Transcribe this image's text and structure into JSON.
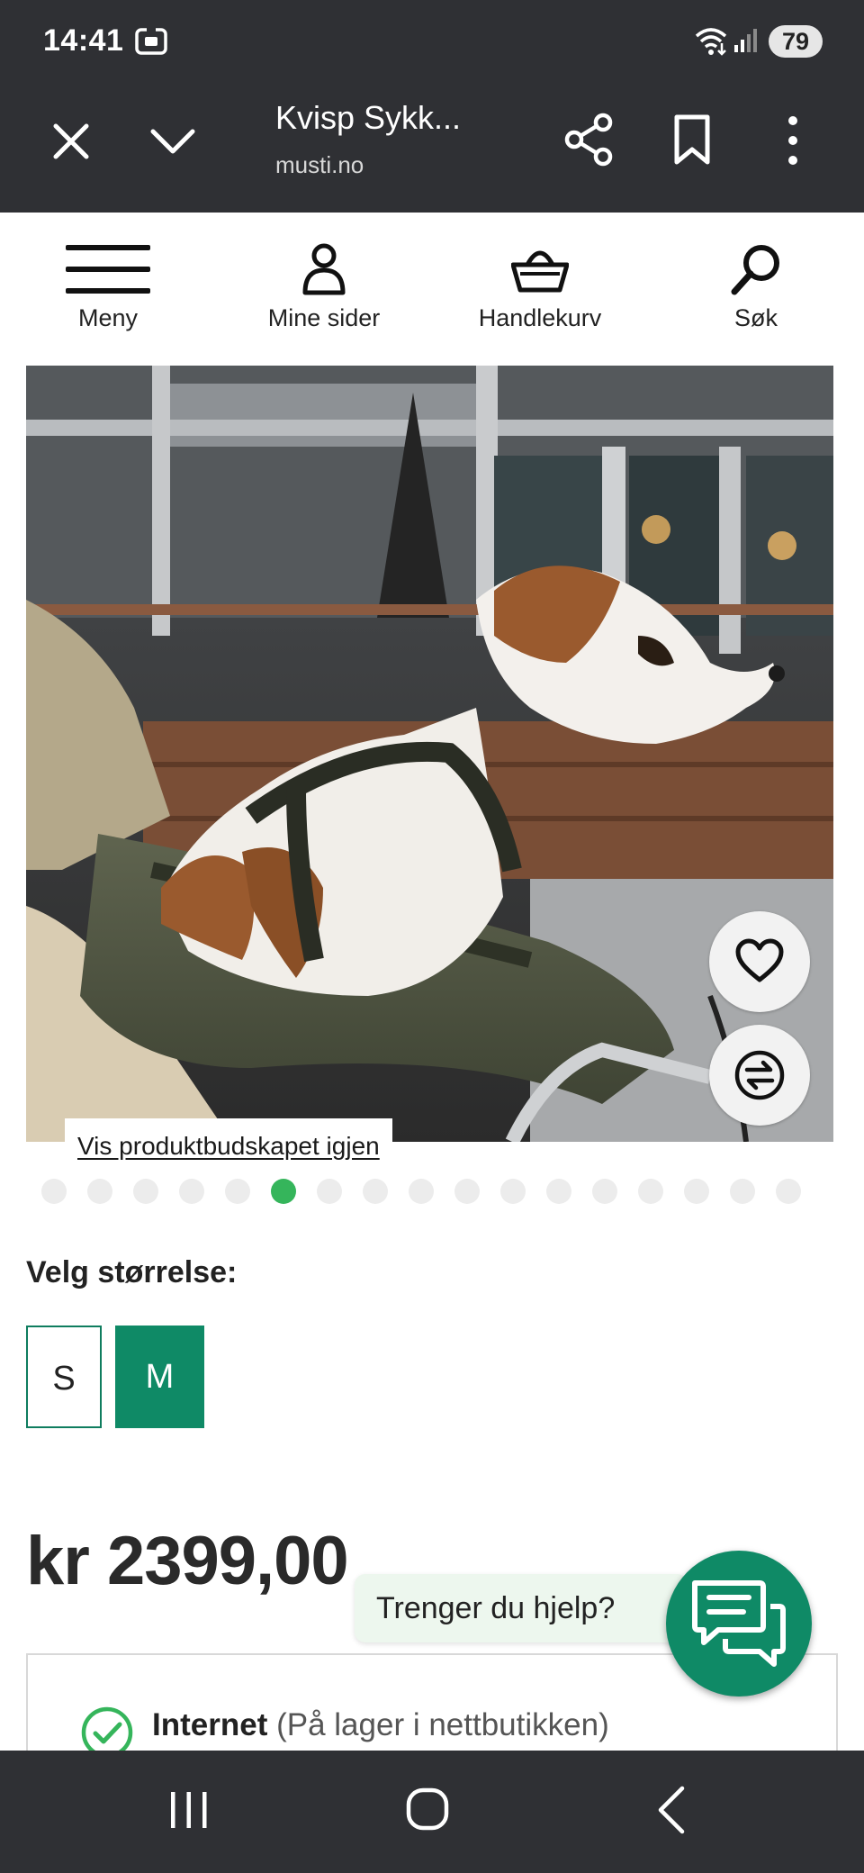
{
  "status_bar": {
    "time": "14:41",
    "battery": "79",
    "icons": [
      "screenshot-icon",
      "wifi-icon",
      "signal-icon"
    ]
  },
  "browser": {
    "tab_title": "Kvisp Sykk...",
    "url": "musti.no",
    "icons": [
      "close-icon",
      "chevron-down-icon",
      "share-icon",
      "bookmark-icon",
      "more-vert-icon"
    ]
  },
  "nav": {
    "menu": "Meny",
    "account": "Mine sider",
    "cart": "Handlekurv",
    "search": "Søk"
  },
  "product": {
    "show_message_link": "Vis produktbudskapet igjen",
    "image_count": 17,
    "active_image_index": 5,
    "size_heading": "Velg størrelse:",
    "sizes": [
      {
        "label": "S",
        "selected": false
      },
      {
        "label": "M",
        "selected": true
      }
    ],
    "price": "kr 2399,00"
  },
  "help": {
    "label": "Trenger du hjelp?"
  },
  "stock": {
    "channel": "Internet",
    "detail": "(På lager i nettbutikken)"
  },
  "colors": {
    "brand_green": "#0f8a66",
    "dot_active": "#35b55b",
    "system_bar": "#2f3034"
  }
}
